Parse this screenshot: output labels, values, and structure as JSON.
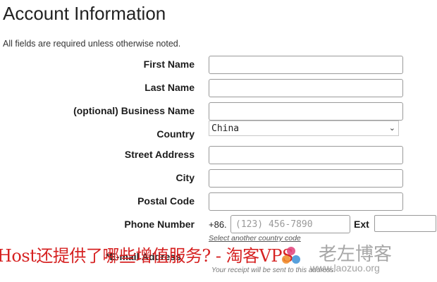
{
  "page": {
    "title": "Account Information",
    "note": "All fields are required unless otherwise noted."
  },
  "form": {
    "first_name_label": "First Name",
    "last_name_label": "Last Name",
    "business_name_label": "(optional) Business Name",
    "country_label": "Country",
    "country_value": "China",
    "street_label": "Street Address",
    "city_label": "City",
    "postal_label": "Postal Code",
    "phone_label": "Phone Number",
    "phone_code": "+86.",
    "phone_placeholder": "(123) 456-7890",
    "ext_label": "Ext",
    "other_country_link": "Select another country code",
    "email_label": "*E-mail Address",
    "receipt_note": "Your receipt will be sent to this address."
  },
  "overlay": {
    "banner": "Host还提供了哪些增值服务? - 淘客VPS",
    "watermark_cn": "老左博客",
    "watermark_url": "www.laozuo.org"
  },
  "colors": {
    "banner_red": "#d62222",
    "watermark_gray": "#8a8a8a"
  }
}
